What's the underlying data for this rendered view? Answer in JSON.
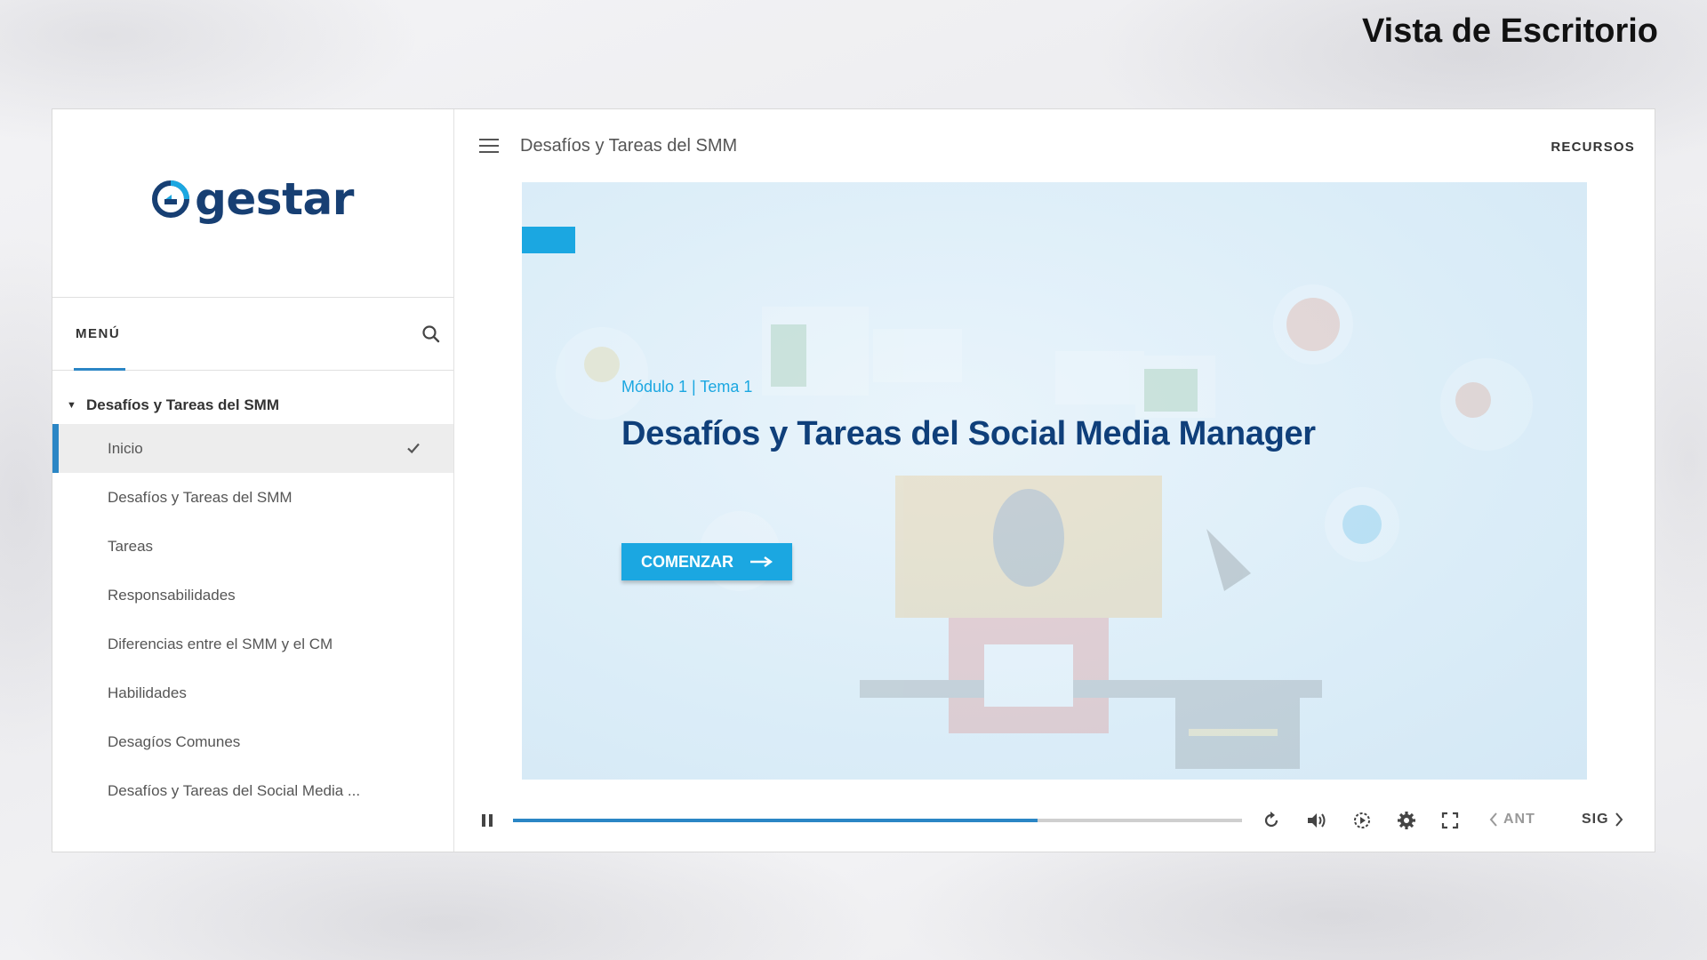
{
  "corner_title": "Vista de Escritorio",
  "brand": {
    "name": "gestar",
    "color": "#173f73",
    "accent": "#1ba7e1"
  },
  "sidebar": {
    "menu_label": "MENÚ",
    "search_icon": "search-icon",
    "section_title": "Desafíos y Tareas del SMM",
    "items": [
      {
        "label": "Inicio",
        "active": true,
        "completed": true
      },
      {
        "label": "Desafíos y Tareas del SMM"
      },
      {
        "label": "Tareas"
      },
      {
        "label": "Responsabilidades"
      },
      {
        "label": "Diferencias entre el SMM y el CM"
      },
      {
        "label": "Habilidades"
      },
      {
        "label": "Desagíos Comunes"
      },
      {
        "label": "Desafíos y Tareas del Social Media ..."
      }
    ]
  },
  "header": {
    "title": "Desafíos y Tareas del SMM",
    "resources_label": "RECURSOS"
  },
  "slide": {
    "subtitle": "Módulo 1 | Tema 1",
    "title": "Desafíos y Tareas del Social Media Manager",
    "start_label": "COMENZAR"
  },
  "player": {
    "progress_percent": 72,
    "prev_label": "ANT",
    "next_label": "SIG",
    "icons": [
      "pause-icon",
      "replay-icon",
      "volume-icon",
      "playback-speed-icon",
      "settings-icon",
      "fullscreen-icon"
    ]
  },
  "colors": {
    "active_indicator": "#2b86c5",
    "active_bg": "#ededed",
    "cta": "#1ba7e1",
    "title": "#0f3f7a"
  }
}
